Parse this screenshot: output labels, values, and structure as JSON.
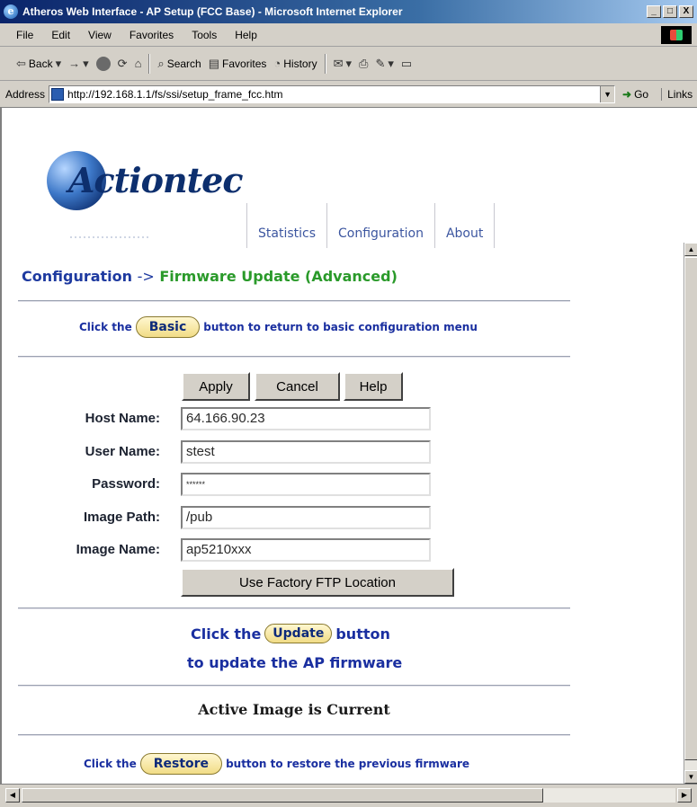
{
  "window": {
    "title": "Atheros Web Interface - AP Setup (FCC Base) - Microsoft Internet Explorer",
    "controls": {
      "minimize": "_",
      "maximize": "□",
      "close": "X"
    }
  },
  "menu": {
    "items": [
      "File",
      "Edit",
      "View",
      "Favorites",
      "Tools",
      "Help"
    ]
  },
  "toolbar": {
    "back": "Back",
    "search": "Search",
    "favorites": "Favorites",
    "history": "History"
  },
  "address": {
    "label": "Address",
    "url": "http://192.168.1.1/fs/ssi/setup_frame_fcc.htm",
    "go": "Go",
    "links": "Links"
  },
  "page": {
    "logo_text": "Actiontec",
    "nav": [
      "Statistics",
      "Configuration",
      "About"
    ],
    "breadcrumb": {
      "section": "Configuration",
      "arrow": "->",
      "page": "Firmware Update (Advanced)"
    },
    "basic_line": {
      "prefix": "Click the",
      "button": "Basic",
      "suffix": "button to return to basic configuration menu"
    },
    "actions": {
      "apply": "Apply",
      "cancel": "Cancel",
      "help": "Help"
    },
    "fields": {
      "host_name": {
        "label": "Host Name:",
        "value": "64.166.90.23"
      },
      "user_name": {
        "label": "User Name:",
        "value": "stest"
      },
      "password": {
        "label": "Password:",
        "value": "******"
      },
      "image_path": {
        "label": "Image Path:",
        "value": "/pub"
      },
      "image_name": {
        "label": "Image Name:",
        "value": "ap5210xxx"
      }
    },
    "factory_button": "Use Factory FTP Location",
    "update_line": {
      "prefix": "Click the",
      "button": "Update",
      "suffix": "button",
      "line2": "to update the AP firmware"
    },
    "status": "Active Image is Current",
    "restore_line": {
      "prefix": "Click the",
      "button": "Restore",
      "suffix": "button to restore the previous firmware"
    }
  },
  "colors": {
    "link_blue": "#1e3aa0",
    "breadcrumb_green": "#2a9a2a",
    "pill_fill": "#f1dc86",
    "chrome": "#d4d0c8"
  }
}
